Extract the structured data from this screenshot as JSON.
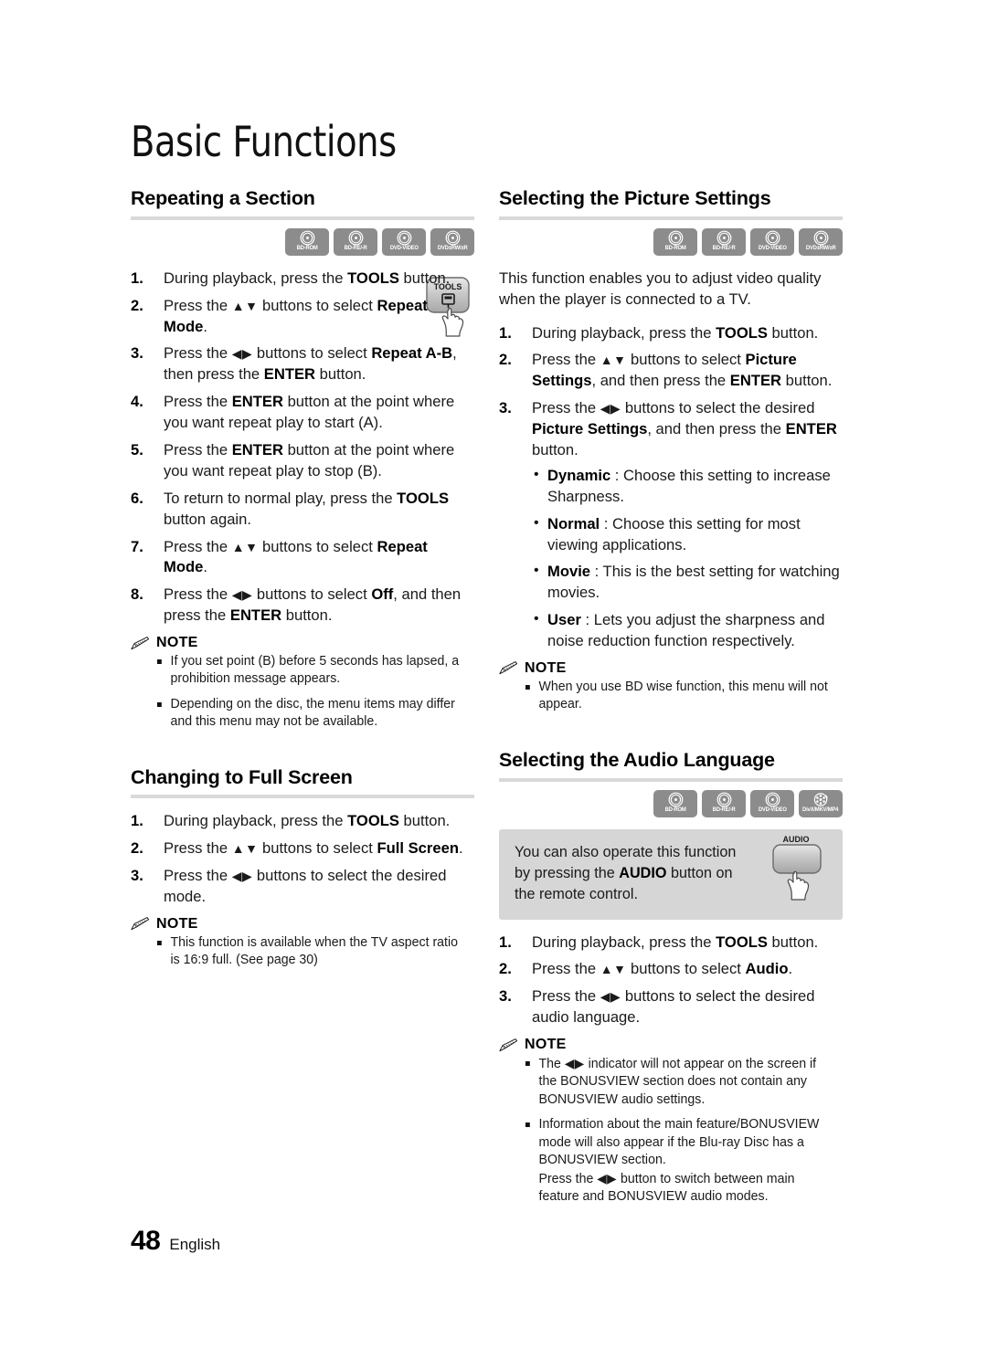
{
  "page": {
    "chapter_title": "Basic Functions",
    "page_number": "48",
    "language": "English"
  },
  "disc_icons": {
    "bd_rom": "BD-ROM",
    "bd_re_r": "BD-RE/-R",
    "dvd_video": "DVD-VIDEO",
    "dvd_rw_r": "DVD±RW/±R",
    "divx_mkv_mp4": "DivX/MKV/MP4"
  },
  "note_label": "NOTE",
  "remote_buttons": {
    "tools": "TOOLS",
    "audio": "AUDIO"
  },
  "sections": {
    "repeating_a_section": {
      "heading": "Repeating a Section",
      "discs": [
        "BD-ROM",
        "BD-RE/-R",
        "DVD-VIDEO",
        "DVD±RW/±R"
      ],
      "steps": [
        {
          "num": "1.",
          "html": "During playback, press the <b>TOOLS</b> button."
        },
        {
          "num": "2.",
          "html": "Press the <span class=\"arrows\">▲▼</span> buttons to select <b>Repeat Mode</b>."
        },
        {
          "num": "3.",
          "html": "Press the <span class=\"arrows\">◀▶</span> buttons to select <b>Repeat A-B</b>, then press the <b>ENTER</b> button."
        },
        {
          "num": "4.",
          "html": "Press the <b>ENTER</b> button at the point where you want repeat play to start (A)."
        },
        {
          "num": "5.",
          "html": "Press the <b>ENTER</b> button at the point where you want repeat play to stop (B)."
        },
        {
          "num": "6.",
          "html": "To return to normal play, press the <b>TOOLS</b> button again."
        },
        {
          "num": "7.",
          "html": "Press the <span class=\"arrows\">▲▼</span> buttons to select <b>Repeat Mode</b>."
        },
        {
          "num": "8.",
          "html": "Press the <span class=\"arrows\">◀▶</span> buttons to select <b>Off</b>, and then press the <b>ENTER</b> button."
        }
      ],
      "notes": [
        "If you set point (B) before 5 seconds has lapsed, a prohibition message appears.",
        "Depending on the disc, the menu items may differ and this menu may not be available."
      ]
    },
    "changing_to_full_screen": {
      "heading": "Changing to Full Screen",
      "steps": [
        {
          "num": "1.",
          "html": "During playback, press the <b>TOOLS</b> button."
        },
        {
          "num": "2.",
          "html": "Press the <span class=\"arrows\">▲▼</span> buttons to select <b>Full Screen</b>."
        },
        {
          "num": "3.",
          "html": "Press the <span class=\"arrows\">◀▶</span> buttons to select the desired mode."
        }
      ],
      "notes": [
        "This function is available when the TV aspect ratio is 16:9 full. (See page 30)"
      ]
    },
    "selecting_the_picture_settings": {
      "heading": "Selecting the Picture Settings",
      "discs": [
        "BD-ROM",
        "BD-RE/-R",
        "DVD-VIDEO",
        "DVD±RW/±R"
      ],
      "intro": "This function enables you to adjust video quality when the player is connected to a TV.",
      "steps": [
        {
          "num": "1.",
          "html": "During playback, press the <b>TOOLS</b> button."
        },
        {
          "num": "2.",
          "html": "Press the <span class=\"arrows\">▲▼</span> buttons to select <b>Picture Settings</b>, and then press the <b>ENTER</b> button."
        },
        {
          "num": "3.",
          "html": "Press the <span class=\"arrows\">◀▶</span> buttons to select the desired <b>Picture Settings</b>, and then press the <b>ENTER</b> button."
        }
      ],
      "options": [
        {
          "html": "<b>Dynamic</b> : Choose this setting to increase Sharpness."
        },
        {
          "html": "<b>Normal</b> : Choose this setting for most viewing applications."
        },
        {
          "html": "<b>Movie</b> : This is the best setting for watching movies."
        },
        {
          "html": "<b>User</b> : Lets you adjust the sharpness and noise reduction function respectively."
        }
      ],
      "notes": [
        "When you use BD wise function, this menu will not appear."
      ]
    },
    "selecting_the_audio_language": {
      "heading": "Selecting the Audio Language",
      "discs": [
        "BD-ROM",
        "BD-RE/-R",
        "DVD-VIDEO",
        "DivX/MKV/MP4"
      ],
      "info_box_html": "You can also operate this function by pressing the <b>AUDIO</b> button on the remote control.",
      "steps": [
        {
          "num": "1.",
          "html": "During playback, press the <b>TOOLS</b> button."
        },
        {
          "num": "2.",
          "html": "Press the <span class=\"arrows\">▲▼</span> buttons to select <b>Audio</b>."
        },
        {
          "num": "3.",
          "html": "Press the <span class=\"arrows\">◀▶</span> buttons to select the desired audio language."
        }
      ],
      "notes": [
        "The <span class=\"arrows\">◀▶</span> indicator will not appear on the screen if the BONUSVIEW section does not contain any BONUSVIEW audio settings.",
        "Information about the main feature/BONUSVIEW mode will also appear if the Blu-ray Disc has a BONUSVIEW section.<br>Press the <span class=\"arrows\">◀▶</span> button to switch between main feature and BONUSVIEW audio modes."
      ]
    }
  }
}
